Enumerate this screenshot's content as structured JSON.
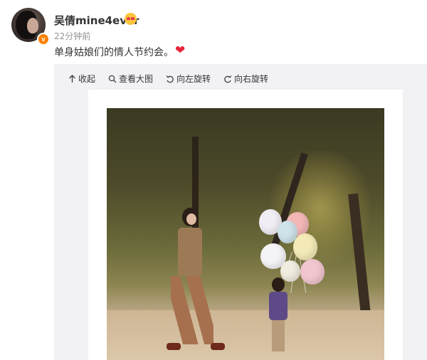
{
  "post": {
    "username": "吴倩mine4ever",
    "timestamp": "22分钟前",
    "text": "单身姑娘们的情人节约会。",
    "heart": "❤",
    "verified_badge": "v"
  },
  "toolbar": {
    "collapse": {
      "icon": "arrow-up-icon",
      "label": "收起"
    },
    "view_large": {
      "icon": "magnifier-icon",
      "label": "查看大图"
    },
    "rotate_left": {
      "icon": "rotate-left-icon",
      "label": "向左旋转"
    },
    "rotate_right": {
      "icon": "rotate-right-icon",
      "label": "向右旋转"
    }
  },
  "colors": {
    "heart": "#e8243a",
    "badge": "#ff8200",
    "panel_bg": "#f2f2f5",
    "muted_text": "#939393"
  }
}
